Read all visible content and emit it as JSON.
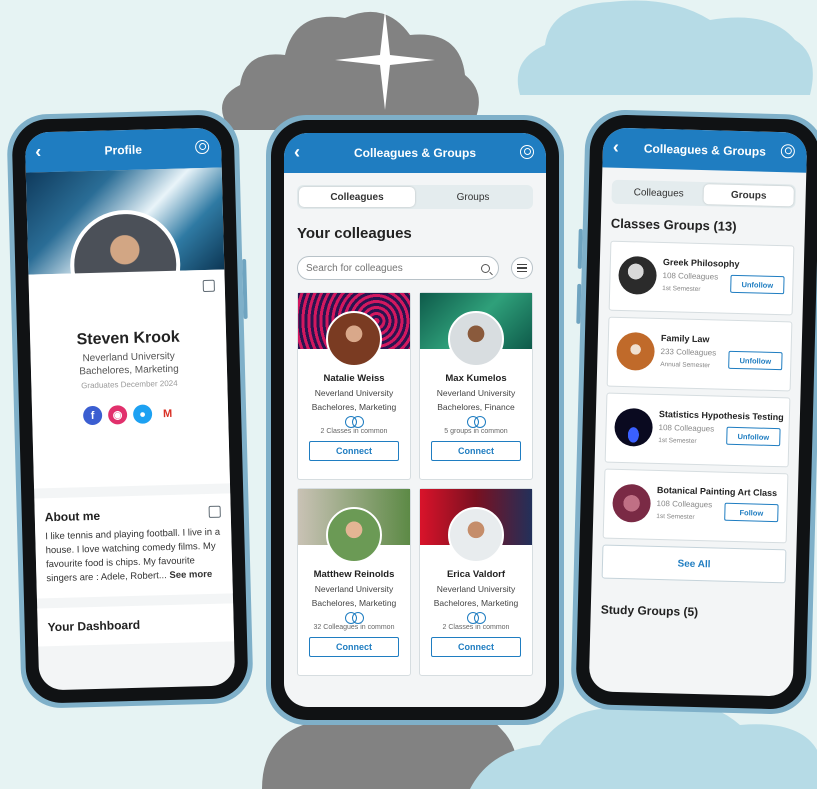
{
  "colors": {
    "brand_blue": "#1f7dc1",
    "background": "#e6f3f3",
    "cloud_grey": "#828282",
    "cloud_blue": "#b6dbe6"
  },
  "left": {
    "header_title": "Profile",
    "name": "Steven Krook",
    "university": "Neverland University",
    "degree": "Bachelores, Marketing",
    "graduation": "Graduates December 2024",
    "socials": [
      "facebook-icon",
      "instagram-icon",
      "twitter-icon",
      "gmail-icon"
    ],
    "about_title": "About me",
    "about_text": "I like tennis and playing football. I live in a house. I love watching comedy films. My favourite food is chips. My favourite singers are : Adele, Robert...",
    "see_more": "See more",
    "dashboard_title": "Your Dashboard"
  },
  "middle": {
    "header_title": "Colleagues & Groups",
    "tabs": [
      "Colleagues",
      "Groups"
    ],
    "section_title": "Your colleagues",
    "search_placeholder": "Search for colleagues",
    "cards": [
      {
        "name": "Natalie Weiss",
        "university": "Neverland University",
        "degree": "Bachelores, Marketing",
        "common": "2 Classes in common",
        "button": "Connect"
      },
      {
        "name": "Max Kumelos",
        "university": "Neverland University",
        "degree": "Bachelores, Finance",
        "common": "5 groups in common",
        "button": "Connect"
      },
      {
        "name": "Matthew Reinolds",
        "university": "Neverland University",
        "degree": "Bachelores, Marketing",
        "common": "32 Colleagues in common",
        "button": "Connect"
      },
      {
        "name": "Erica Valdorf",
        "university": "Neverland University",
        "degree": "Bachelores, Marketing",
        "common": "2 Classes in common",
        "button": "Connect"
      }
    ]
  },
  "right": {
    "header_title": "Colleagues & Groups",
    "tabs": [
      "Colleagues",
      "Groups"
    ],
    "classes_title": "Classes Groups (13)",
    "classes": [
      {
        "name": "Greek Philosophy",
        "count": "108 Colleagues",
        "semester": "1st Semester",
        "button": "Unfollow"
      },
      {
        "name": "Family Law",
        "count": "233 Colleagues",
        "semester": "Annual Semester",
        "button": "Unfollow"
      },
      {
        "name": "Statistics Hypothesis Testing",
        "count": "108 Colleagues",
        "semester": "1st Semester",
        "button": "Unfollow"
      },
      {
        "name": "Botanical Painting Art Class",
        "count": "108 Colleagues",
        "semester": "1st Semester",
        "button": "Follow"
      }
    ],
    "see_all": "See All",
    "study_title": "Study Groups (5)"
  }
}
